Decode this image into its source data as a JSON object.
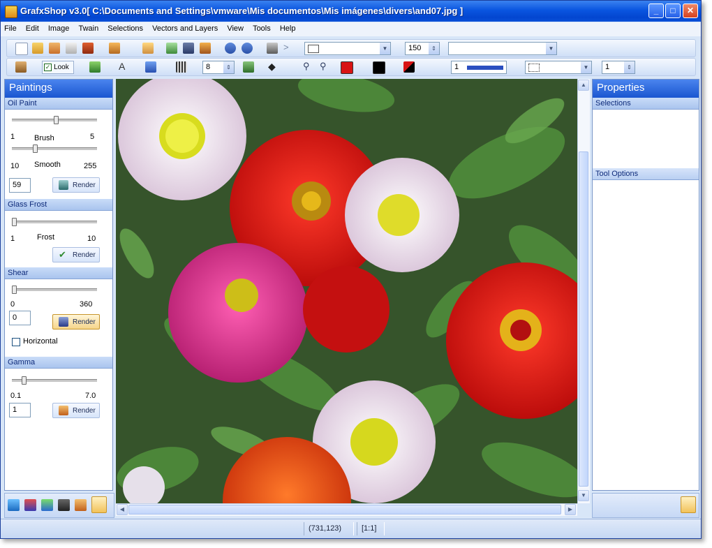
{
  "window": {
    "title": "GrafxShop v3.0[ C:\\Documents and Settings\\vmware\\Mis documentos\\Mis imágenes\\divers\\and07.jpg ]",
    "minimize_glyph": "_",
    "maximize_glyph": "□",
    "close_glyph": "✕"
  },
  "menu": [
    "File",
    "Edit",
    "Image",
    "Twain",
    "Selections",
    "Vectors and Layers",
    "View",
    "Tools",
    "Help"
  ],
  "toolbar": {
    "zoom_value": "150",
    "lock_label": "Look",
    "line_width": "1",
    "size_value": "8",
    "spare_value": "1"
  },
  "left_panel": {
    "title": "Paintings",
    "oil_paint": {
      "header": "Oil Paint",
      "brush_min": "1",
      "brush_label": "Brush",
      "brush_max": "5",
      "smooth_min": "10",
      "smooth_label": "Smooth",
      "smooth_max": "255",
      "value": "59",
      "render": "Render"
    },
    "glass_frost": {
      "header": "Glass Frost",
      "frost_min": "1",
      "frost_label": "Frost",
      "frost_max": "10",
      "render": "Render"
    },
    "shear": {
      "header": "Shear",
      "min": "0",
      "max": "360",
      "value": "0",
      "render": "Render",
      "horizontal_label": "Horizontal"
    },
    "gamma": {
      "header": "Gamma",
      "min": "0.1",
      "max": "7.0",
      "value": "1",
      "render": "Render"
    }
  },
  "right_panel": {
    "title": "Properties",
    "selections_header": "Selections",
    "tool_options_header": "Tool Options"
  },
  "status": {
    "coords": "(731,123)",
    "zoom": "[1:1]"
  },
  "colors": {
    "foreground": "#d81414",
    "background": "#000000",
    "accent": "#0a55e0"
  }
}
